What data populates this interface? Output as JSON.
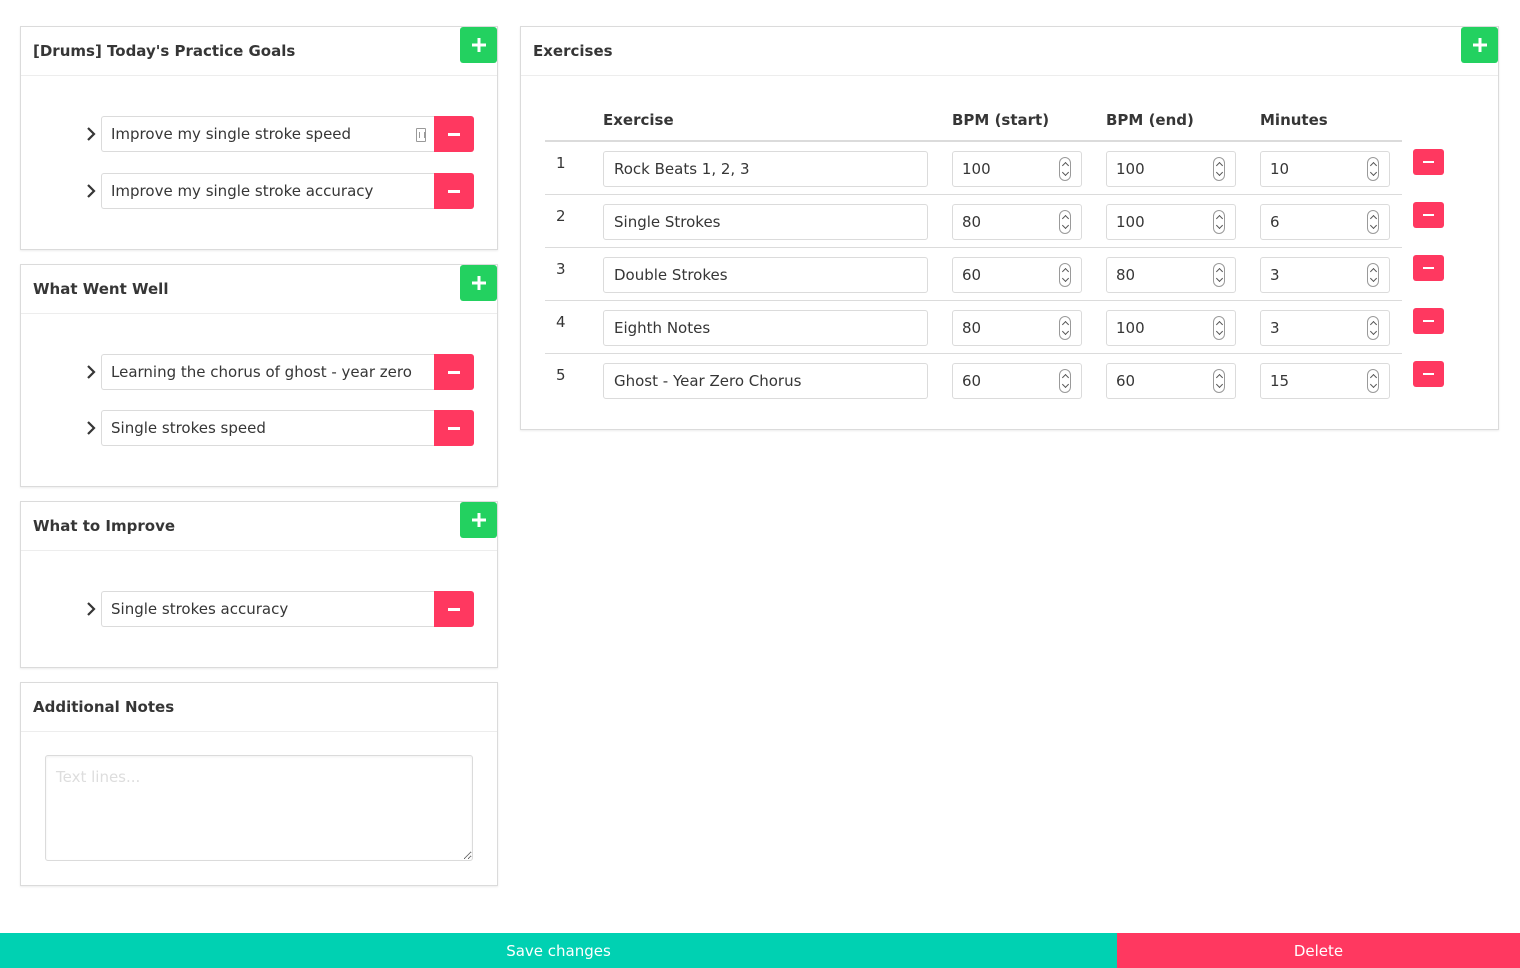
{
  "goals": {
    "title": "[Drums] Today's Practice Goals",
    "items": [
      {
        "text": "Improve my single stroke speed"
      },
      {
        "text": "Improve my single stroke accuracy"
      }
    ]
  },
  "went_well": {
    "title": "What Went Well",
    "items": [
      {
        "text": "Learning the chorus of ghost - year zero"
      },
      {
        "text": "Single strokes speed"
      }
    ]
  },
  "to_improve": {
    "title": "What to Improve",
    "items": [
      {
        "text": "Single strokes accuracy"
      }
    ]
  },
  "notes": {
    "title": "Additional Notes",
    "placeholder": "Text lines..."
  },
  "exercises": {
    "title": "Exercises",
    "columns": [
      "Exercise",
      "BPM (start)",
      "BPM (end)",
      "Minutes"
    ],
    "rows": [
      {
        "num": "1",
        "name": "Rock Beats 1, 2, 3",
        "bpm_start": "100",
        "bpm_end": "100",
        "minutes": "10"
      },
      {
        "num": "2",
        "name": "Single Strokes",
        "bpm_start": "80",
        "bpm_end": "100",
        "minutes": "6"
      },
      {
        "num": "3",
        "name": "Double Strokes",
        "bpm_start": "60",
        "bpm_end": "80",
        "minutes": "3"
      },
      {
        "num": "4",
        "name": "Eighth Notes",
        "bpm_start": "80",
        "bpm_end": "100",
        "minutes": "3"
      },
      {
        "num": "5",
        "name": "Ghost - Year Zero Chorus",
        "bpm_start": "60",
        "bpm_end": "60",
        "minutes": "15"
      }
    ]
  },
  "footer": {
    "save_label": "Save changes",
    "delete_label": "Delete"
  },
  "colors": {
    "add": "#23d160",
    "remove": "#ff3860",
    "save": "#00d1b2",
    "delete": "#ff3860"
  }
}
